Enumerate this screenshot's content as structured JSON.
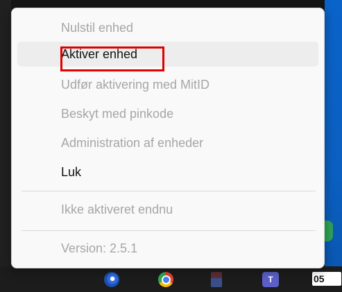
{
  "menu": {
    "items": [
      {
        "label": "Nulstil enhed",
        "enabled": false
      },
      {
        "label": "Aktiver enhed",
        "enabled": true
      },
      {
        "label": "Udfør aktivering med MitID",
        "enabled": false
      },
      {
        "label": "Beskyt med pinkode",
        "enabled": false
      },
      {
        "label": "Administration af enheder",
        "enabled": false
      },
      {
        "label": "Luk",
        "enabled": true
      }
    ],
    "status": "Ikke aktiveret endnu",
    "version": "Version: 2.5.1"
  },
  "taskbar": {
    "icons": [
      "edge-icon",
      "chrome-icon",
      "task-app-icon",
      "teams-icon",
      "clock-icon"
    ],
    "teams_letter": "T",
    "clock_text": "05"
  },
  "colors": {
    "highlight": "#e00000",
    "menu_bg": "#f9f9f9",
    "disabled_text": "#a6a6a6",
    "enabled_text": "#111111"
  }
}
